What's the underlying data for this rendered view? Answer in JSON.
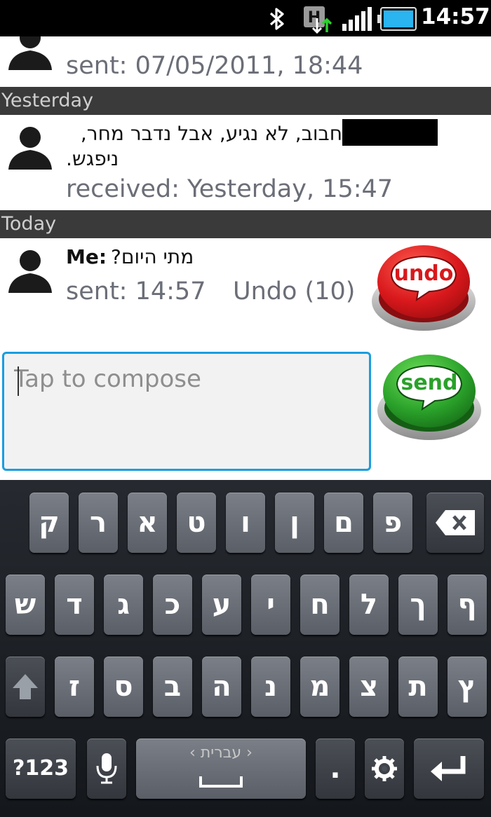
{
  "status_bar": {
    "time": "14:57",
    "icons": [
      "bluetooth-icon",
      "hplus-data-icon",
      "signal-icon",
      "battery-icon"
    ]
  },
  "messages": [
    {
      "meta": "sent: 07/05/2011, 18:44"
    },
    {
      "section": "Yesterday",
      "line1": "חבוב, לא נגיע, אבל נדבר מחר,",
      "line2": "ניפגש.",
      "meta": "received: Yesterday, 15:47"
    },
    {
      "section": "Today",
      "sender": "Me:",
      "text": "מתי היום?",
      "meta": "sent: 14:57",
      "undo_label": "Undo (10)"
    }
  ],
  "undo_button": {
    "label": "undo",
    "color": "#d8181c"
  },
  "send_button": {
    "label": "send",
    "color": "#2aa12a"
  },
  "compose": {
    "placeholder": "Tap to compose",
    "border_color": "#1a9ee0"
  },
  "keyboard": {
    "row1": [
      "ק",
      "ר",
      "א",
      "ט",
      "ו",
      "ן",
      "ם",
      "פ"
    ],
    "row2": [
      "ש",
      "ד",
      "ג",
      "כ",
      "ע",
      "י",
      "ח",
      "ל",
      "ך",
      "ף"
    ],
    "row3": [
      "ז",
      "ס",
      "ב",
      "ה",
      "נ",
      "מ",
      "צ",
      "ת",
      "ץ"
    ],
    "symbols_label": "?123",
    "language_label": "עברית",
    "period_label": "."
  }
}
